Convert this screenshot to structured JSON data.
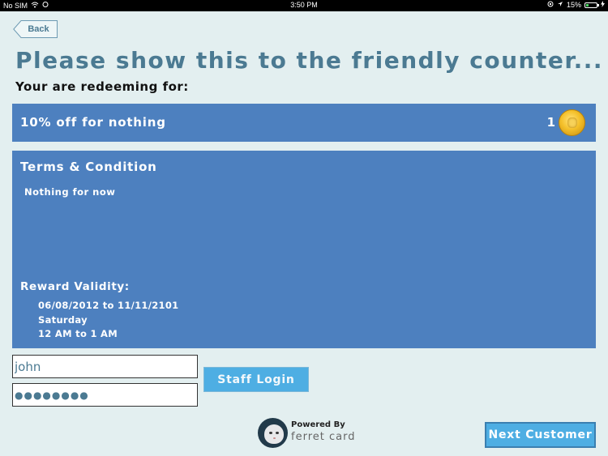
{
  "status_bar": {
    "carrier": "No SIM",
    "time": "3:50 PM",
    "battery_percent": "15%",
    "battery_level": 0.15
  },
  "nav": {
    "back_label": "Back"
  },
  "header": {
    "title": "Please show this to the friendly counter...",
    "subtitle": "Your are redeeming for:"
  },
  "reward": {
    "name": "10% off for nothing",
    "points": "1",
    "icon": "gold-coin-icon"
  },
  "terms": {
    "title": "Terms & Condition",
    "text": "Nothing for now",
    "validity_title": "Reward Validity:",
    "validity_dates": "06/08/2012 to 11/11/2101",
    "validity_day": "Saturday",
    "validity_hours": "12 AM to 1 AM"
  },
  "login": {
    "username_value": "john",
    "password_value": "●●●●●●●●",
    "button_label": "Staff Login"
  },
  "footer": {
    "powered_by": "Powered By",
    "brand": "ferret card",
    "next_button_label": "Next Customer"
  },
  "colors": {
    "background": "#e3eff0",
    "panel": "#4d80bf",
    "button": "#4eaee3",
    "title": "#4b7a92"
  }
}
